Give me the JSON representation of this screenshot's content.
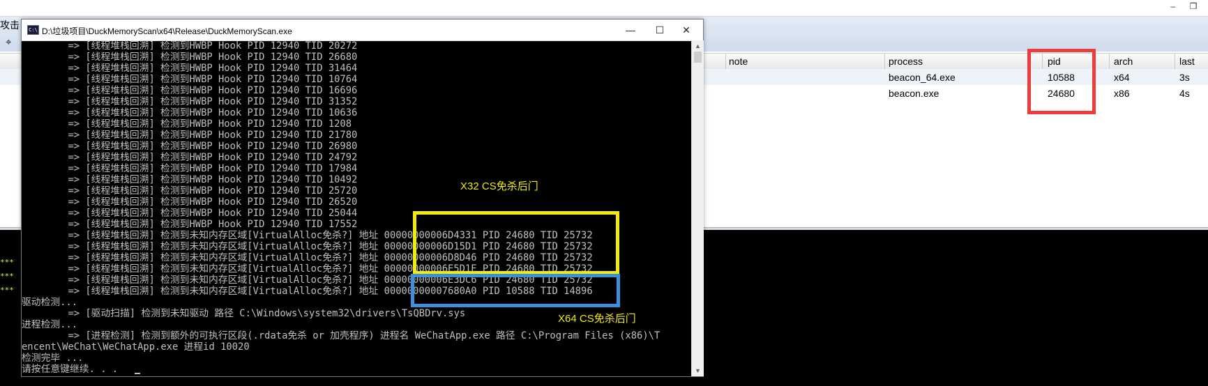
{
  "background_window": {
    "top_controls": [
      "‒",
      "❐"
    ],
    "toolbar": {
      "attack_label": "攻击",
      "crosshair_icon": "crosshair-icon"
    },
    "table": {
      "columns": [
        "note",
        "process",
        "pid",
        "arch",
        "last"
      ],
      "rows": [
        {
          "process": "beacon_64.exe",
          "pid": "10588",
          "arch": "x64",
          "last": "3s"
        },
        {
          "process": "beacon.exe",
          "pid": "24680",
          "arch": "x86",
          "last": "4s"
        }
      ]
    },
    "console_stars": [
      "***",
      "***",
      "***"
    ]
  },
  "cmd_window": {
    "icon_label": "C:\\",
    "title": "D:\\垃圾项目\\DuckMemoryScan\\x64\\Release\\DuckMemoryScan.exe",
    "buttons": {
      "minimize": "—",
      "maximize": "☐",
      "close": "✕"
    },
    "lines": [
      "        => [线程堆栈回溯] 检测到HWBP Hook PID 12940 TID 20272",
      "        => [线程堆栈回溯] 检测到HWBP Hook PID 12940 TID 26680",
      "        => [线程堆栈回溯] 检测到HWBP Hook PID 12940 TID 31464",
      "        => [线程堆栈回溯] 检测到HWBP Hook PID 12940 TID 10764",
      "        => [线程堆栈回溯] 检测到HWBP Hook PID 12940 TID 16696",
      "        => [线程堆栈回溯] 检测到HWBP Hook PID 12940 TID 31352",
      "        => [线程堆栈回溯] 检测到HWBP Hook PID 12940 TID 10636",
      "        => [线程堆栈回溯] 检测到HWBP Hook PID 12940 TID 1208",
      "        => [线程堆栈回溯] 检测到HWBP Hook PID 12940 TID 21780",
      "        => [线程堆栈回溯] 检测到HWBP Hook PID 12940 TID 26980",
      "        => [线程堆栈回溯] 检测到HWBP Hook PID 12940 TID 24792",
      "        => [线程堆栈回溯] 检测到HWBP Hook PID 12940 TID 17984",
      "        => [线程堆栈回溯] 检测到HWBP Hook PID 12940 TID 10492",
      "        => [线程堆栈回溯] 检测到HWBP Hook PID 12940 TID 25720",
      "        => [线程堆栈回溯] 检测到HWBP Hook PID 12940 TID 26520",
      "        => [线程堆栈回溯] 检测到HWBP Hook PID 12940 TID 25044",
      "        => [线程堆栈回溯] 检测到HWBP Hook PID 12940 TID 17552",
      "        => [线程堆栈回溯] 检测到未知内存区域[VirtualAlloc免杀?] 地址 00000000006D4331 PID 24680 TID 25732",
      "        => [线程堆栈回溯] 检测到未知内存区域[VirtualAlloc免杀?] 地址 00000000006D15D1 PID 24680 TID 25732",
      "        => [线程堆栈回溯] 检测到未知内存区域[VirtualAlloc免杀?] 地址 00000000006D8D46 PID 24680 TID 25732",
      "        => [线程堆栈回溯] 检测到未知内存区域[VirtualAlloc免杀?] 地址 00000000006E5D1E PID 24680 TID 25732",
      "        => [线程堆栈回溯] 检测到未知内存区域[VirtualAlloc免杀?] 地址 00000000006E3DC6 PID 24680 TID 25732",
      "        => [线程堆栈回溯] 检测到未知内存区域[VirtualAlloc免杀?] 地址 00000000007680A0 PID 10588 TID 14896",
      "驱动检测...",
      "        => [驱动扫描] 检测到未知驱动 路径 C:\\Windows\\system32\\drivers\\TsQBDrv.sys",
      "进程检测...",
      "        => [进程检测] 检测到额外的可执行区段(.rdata免杀 or 加壳程序) 进程名 WeChatApp.exe 路径 C:\\Program Files (x86)\\T",
      "encent\\WeChat\\WeChatApp.exe 进程id 10020",
      "检测完毕 ...",
      "请按任意键继续. . ."
    ]
  },
  "annotations": {
    "x32_label": "X32 CS免杀后门",
    "x64_label": "X64 CS免杀后门"
  },
  "colors": {
    "red": "#ee3b3b",
    "yellow": "#f2ec0d",
    "blue": "#3b8fdb"
  }
}
